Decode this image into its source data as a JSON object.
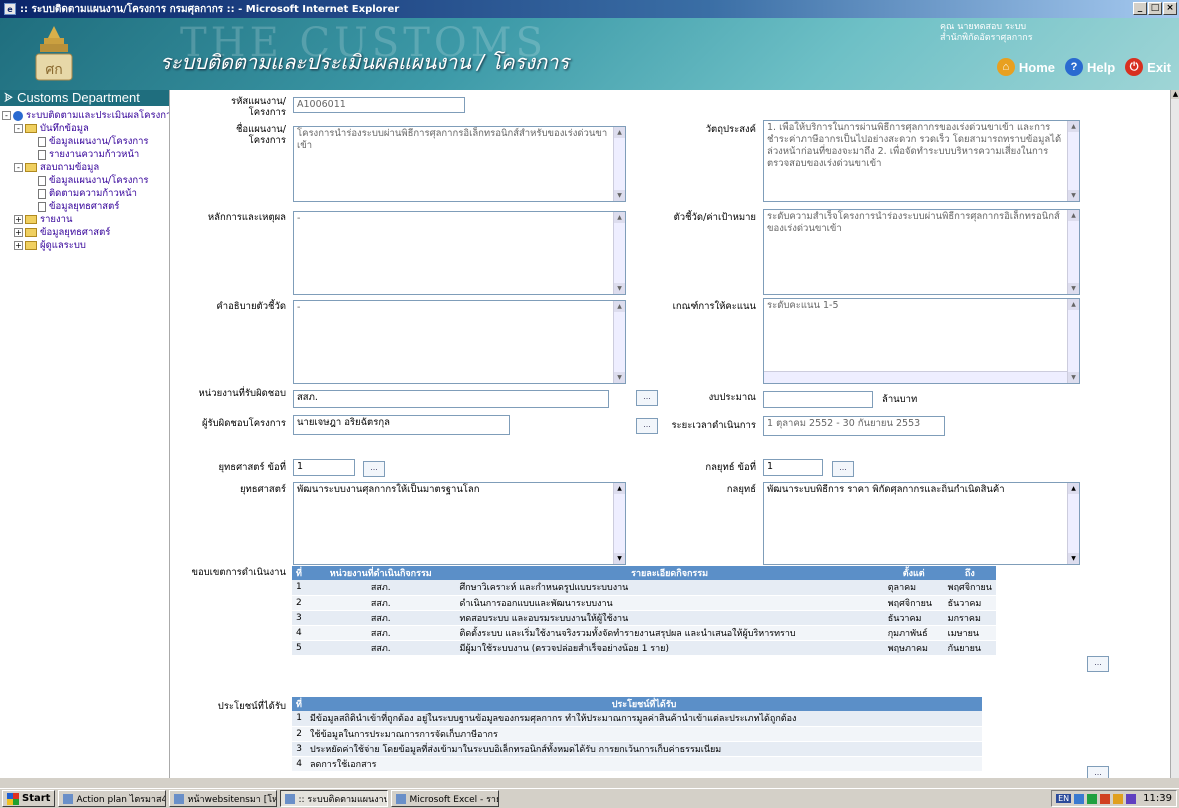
{
  "window": {
    "title": ":: ระบบติดตามแผนงาน/โครงการ กรมศุลกากร :: - Microsoft Internet Explorer"
  },
  "header": {
    "watermark": "THE CUSTOMS",
    "app_title": "ระบบติดตามและประเมินผลแผนงาน / โครงการ",
    "user_line1": "คุณ นายทดสอบ ระบบ",
    "user_line2": "สำนักพิกัดอัตราศุลกากร",
    "nav": {
      "home": "Home",
      "help": "Help",
      "exit": "Exit"
    }
  },
  "sidebar": {
    "heading": "Customs Department",
    "root": "ระบบติดตามและประเมินผลโครงการ",
    "items": [
      {
        "label": "บันทึกข้อมูล",
        "level": 1,
        "type": "folder",
        "pm": "-"
      },
      {
        "label": "ข้อมูลแผนงาน/โครงการ",
        "level": 2,
        "type": "doc",
        "pm": ""
      },
      {
        "label": "รายงานความก้าวหน้า",
        "level": 2,
        "type": "doc",
        "pm": ""
      },
      {
        "label": "สอบถามข้อมูล",
        "level": 1,
        "type": "folder",
        "pm": "-"
      },
      {
        "label": "ข้อมูลแผนงาน/โครงการ",
        "level": 2,
        "type": "doc",
        "pm": ""
      },
      {
        "label": "ติดตามความก้าวหน้า",
        "level": 2,
        "type": "doc",
        "pm": ""
      },
      {
        "label": "ข้อมูลยุทธศาสตร์",
        "level": 2,
        "type": "doc",
        "pm": ""
      },
      {
        "label": "รายงาน",
        "level": 1,
        "type": "folder",
        "pm": "+"
      },
      {
        "label": "ข้อมูลยุทธศาสตร์",
        "level": 1,
        "type": "folder",
        "pm": "+"
      },
      {
        "label": "ผู้ดูแลระบบ",
        "level": 1,
        "type": "folder",
        "pm": "+"
      }
    ]
  },
  "form": {
    "code_label": "รหัสแผนงาน/โครงการ",
    "code_value": "A1006011",
    "name_label": "ชื่อแผนงาน/โครงการ",
    "name_value": "โครงการนำร่องระบบผ่านพิธีการศุลกากรอิเล็กทรอนิกส์สำหรับของเร่งด่วนขาเข้า",
    "objective_label": "วัตถุประสงค์",
    "objective_value": "1. เพื่อให้บริการในการผ่านพิธีการศุลกากรของเร่งด่วนขาเข้า และการชำระค่าภาษีอากรเป็นไปอย่างสะดวก รวดเร็ว โดยสามารถทราบข้อมูลได้ล่วงหน้าก่อนที่ของจะมาถึง 2. เพื่อจัดทำระบบบริหารความเสี่ยงในการตรวจสอบของเร่งด่วนขาเข้า",
    "rationale_label": "หลักการและเหตุผล",
    "rationale_value": "-",
    "kpi_label": "ตัวชี้วัด/ค่าเป้าหมาย",
    "kpi_value": "ระดับความสำเร็จโครงการนำร่องระบบผ่านพิธีการศุลกากรอิเล็กทรอนิกส์ของเร่งด่วนขาเข้า",
    "kpi_desc_label": "คำอธิบายตัวชี้วัด",
    "kpi_desc_value": "-",
    "criteria_label": "เกณฑ์การให้คะแนน",
    "criteria_value": "ระดับคะแนน 1-5",
    "unit_label": "หน่วยงานที่รับผิดชอบ",
    "unit_value": "สสภ.",
    "budget_label": "งบประมาณ",
    "budget_value": "",
    "budget_unit": "ล้านบาท",
    "owner_label": "ผู้รับผิดชอบโครงการ",
    "owner_value": "นายเจษฎา อริยฉัตรกุล",
    "period_label": "ระยะเวลาดำเนินการ",
    "period_value": "1 ตุลาคม 2552 - 30 กันยายน 2553",
    "strategy_no_label": "ยุทธศาสตร์ ข้อที่",
    "strategy_no_value": "1",
    "tactic_no_label": "กลยุทธ์ ข้อที่",
    "tactic_no_value": "1",
    "strategy_label": "ยุทธศาสตร์",
    "strategy_value": "พัฒนาระบบงานศุลกากรให้เป็นมาตรฐานโลก",
    "tactic_label": "กลยุทธ์",
    "tactic_value": "พัฒนาระบบพิธีการ ราคา พิกัดศุลกากรและถิ่นกำเนิดสินค้า",
    "dots": "...",
    "scope_label": "ขอบเขตการดำเนินงาน",
    "benefit_label": "ประโยชน์ที่ได้รับ"
  },
  "activities": {
    "headers": [
      "ที่",
      "หน่วยงานที่ดำเนินกิจกรรม",
      "รายละเอียดกิจกรรม",
      "ตั้งแต่",
      "ถึง"
    ],
    "rows": [
      [
        "1",
        "สสภ.",
        "ศึกษาวิเคราะห์ และกำหนดรูปแบบระบบงาน",
        "ตุลาคม",
        "พฤศจิกายน"
      ],
      [
        "2",
        "สสภ.",
        "ดำเนินการออกแบบและพัฒนาระบบงาน",
        "พฤศจิกายน",
        "ธันวาคม"
      ],
      [
        "3",
        "สสภ.",
        "ทดสอบระบบ และอบรมระบบงานให้ผู้ใช้งาน",
        "ธันวาคม",
        "มกราคม"
      ],
      [
        "4",
        "สสภ.",
        "ติดตั้งระบบ และเริ่มใช้งานจริงรวมทั้งจัดทำรายงานสรุปผล และนำเสนอให้ผู้บริหารทราบ",
        "กุมภาพันธ์",
        "เมษายน"
      ],
      [
        "5",
        "สสภ.",
        "มีผู้มาใช้ระบบงาน (ตรวจปล่อยสำเร็จอย่างน้อย 1 ราย)",
        "พฤษภาคม",
        "กันยายน"
      ]
    ]
  },
  "benefits": {
    "headers": [
      "ที่",
      "ประโยชน์ที่ได้รับ"
    ],
    "rows": [
      [
        "1",
        "มีข้อมูลสถิตินำเข้าที่ถูกต้อง อยู่ในระบบฐานข้อมูลของกรมศุลกากร ทำให้ประมาณการมูลค่าสินค้านำเข้าแต่ละประเภทได้ถูกต้อง"
      ],
      [
        "2",
        "ใช้ข้อมูลในการประมาณการการจัดเก็บภาษีอากร"
      ],
      [
        "3",
        "ประหยัดค่าใช้จ่าย โดยข้อมูลที่ส่งเข้ามาในระบบอิเล็กทรอนิกส์ทั้งหมดได้รับ การยกเว้นการเก็บค่าธรรมเนียม"
      ],
      [
        "4",
        "ลดการใช้เอกสาร"
      ]
    ]
  },
  "taskbar": {
    "start": "Start",
    "tasks": [
      "Action plan ไตรมาส4 ...",
      "หน้าwebsitensมา [โหม...",
      ":: ระบบติดตามแผนงาน/...",
      "Microsoft Excel - รายง..."
    ],
    "active_index": 2,
    "lang": "EN",
    "clock": "11:39"
  }
}
